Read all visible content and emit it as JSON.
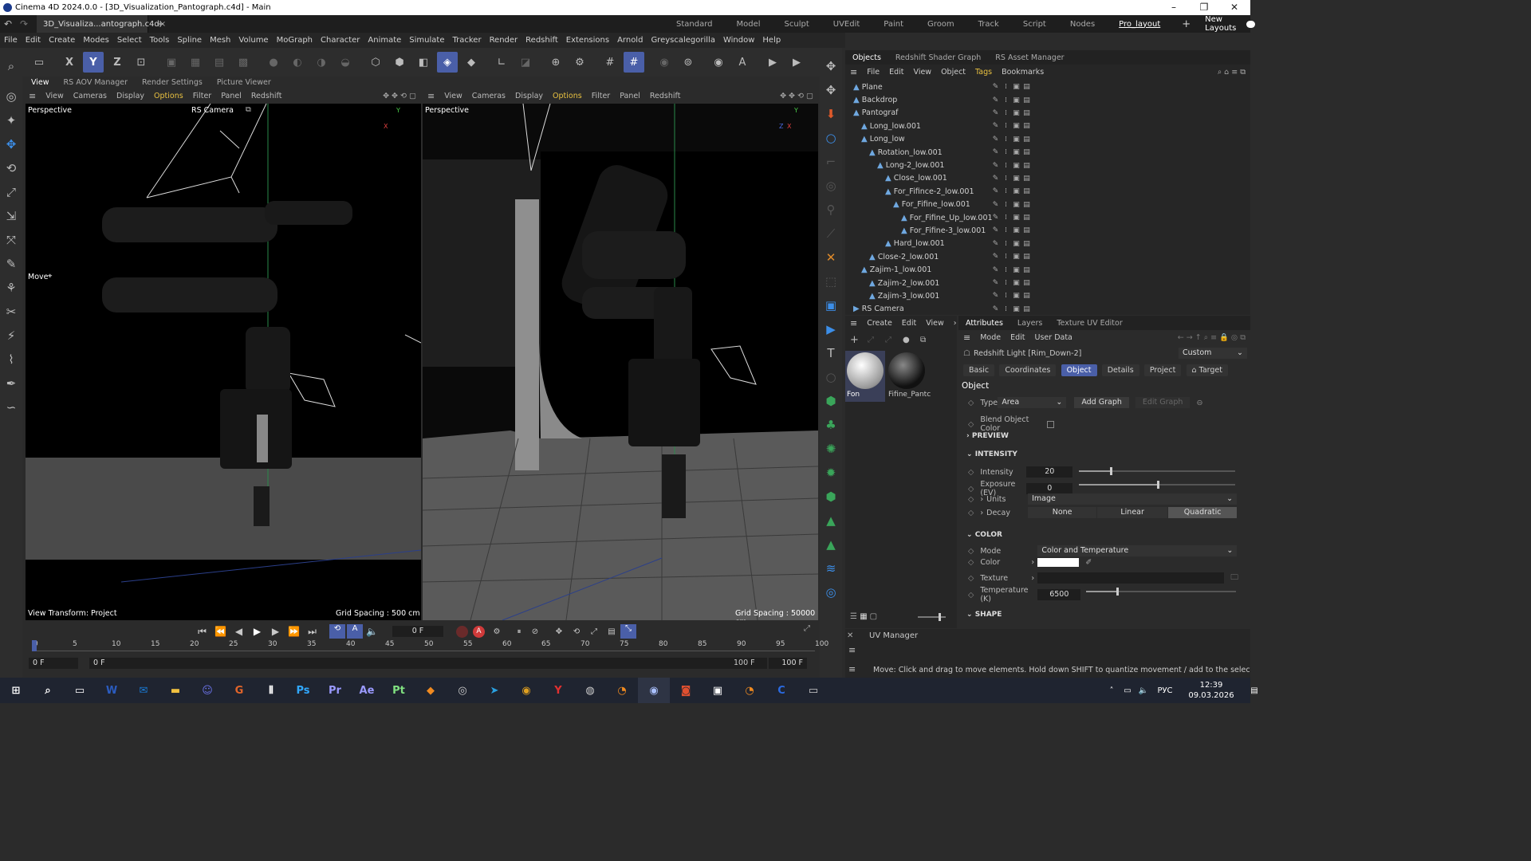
{
  "window": {
    "title": "Cinema 4D 2024.0.0 - [3D_Visualization_Pantograph.c4d] - Main",
    "controls": [
      "–",
      "❐",
      "✕"
    ]
  },
  "tabbar": {
    "doc_tab": "3D_Visualiza...antograph.c4d",
    "close": "×",
    "add": "+",
    "layouts": [
      "Standard",
      "Model",
      "Sculpt",
      "UVEdit",
      "Paint",
      "Groom",
      "Track",
      "Script",
      "Nodes",
      "Pro_layout"
    ],
    "active_layout": "Pro_layout",
    "new_layouts": "New Layouts"
  },
  "menu": [
    "File",
    "Edit",
    "Create",
    "Modes",
    "Select",
    "Tools",
    "Spline",
    "Mesh",
    "Volume",
    "MoGraph",
    "Character",
    "Animate",
    "Simulate",
    "Tracker",
    "Render",
    "Redshift",
    "Extensions",
    "Arnold",
    "Greyscalegorilla",
    "Window",
    "Help"
  ],
  "toolbar": {
    "axis": [
      "X",
      "Y",
      "Z"
    ]
  },
  "view_tabs": [
    "View",
    "RS AOV Manager",
    "Render Settings",
    "Picture Viewer"
  ],
  "viewport_menu": [
    "View",
    "Cameras",
    "Display",
    "Options",
    "Filter",
    "Panel",
    "Redshift"
  ],
  "viewport_left": {
    "label": "Perspective",
    "camera": "RS Camera",
    "tool_hint": "Move",
    "view_transform": "View Transform: Project",
    "grid": "Grid Spacing : 500 cm",
    "axis_labels": [
      "Y",
      "X"
    ]
  },
  "viewport_right": {
    "label": "Perspective",
    "grid": "Grid Spacing : 50000 cm",
    "axis_labels": [
      "Y",
      "Z",
      "X"
    ]
  },
  "objects_panel": {
    "tabs": [
      "Objects",
      "Redshift Shader Graph",
      "RS Asset Manager"
    ],
    "menu": [
      "File",
      "Edit",
      "View",
      "Object",
      "Tags",
      "Bookmarks"
    ],
    "items": [
      {
        "name": "Plane",
        "depth": 0
      },
      {
        "name": "Backdrop",
        "depth": 0
      },
      {
        "name": "Pantograf",
        "depth": 0
      },
      {
        "name": "Long_low.001",
        "depth": 1
      },
      {
        "name": "Long_low",
        "depth": 1
      },
      {
        "name": "Rotation_low.001",
        "depth": 2
      },
      {
        "name": "Long-2_low.001",
        "depth": 3
      },
      {
        "name": "Close_low.001",
        "depth": 4
      },
      {
        "name": "For_Fifince-2_low.001",
        "depth": 4
      },
      {
        "name": "For_Fifine_low.001",
        "depth": 5
      },
      {
        "name": "For_Fifine_Up_low.001",
        "depth": 6
      },
      {
        "name": "For_Fifine-3_low.001",
        "depth": 6
      },
      {
        "name": "Hard_low.001",
        "depth": 4
      },
      {
        "name": "Close-2_low.001",
        "depth": 2
      },
      {
        "name": "Zajim-1_low.001",
        "depth": 1
      },
      {
        "name": "Zajim-2_low.001",
        "depth": 2
      },
      {
        "name": "Zajim-3_low.001",
        "depth": 2
      },
      {
        "name": "RS Camera",
        "depth": 0
      }
    ]
  },
  "materials": {
    "menu": [
      "Create",
      "Edit",
      "View",
      "›"
    ],
    "items": [
      "Fon",
      "Fifine_Pantc"
    ]
  },
  "attributes": {
    "tabs": [
      "Attributes",
      "Layers",
      "Texture UV Editor"
    ],
    "menu": [
      "Mode",
      "Edit",
      "User Data"
    ],
    "object_name": "Redshift Light [Rim_Down-2]",
    "preset": "Custom",
    "subtabs": [
      "Basic",
      "Coordinates",
      "Object",
      "Details",
      "Project",
      "Target"
    ],
    "active_subtab": "Object",
    "section_object": "Object",
    "type_label": "Type",
    "type_value": "Area",
    "add_graph": "Add Graph",
    "edit_graph": "Edit Graph",
    "blend_label": "Blend Object Color",
    "preview": "PREVIEW",
    "intensity_section": "INTENSITY",
    "intensity_label": "Intensity",
    "intensity_value": "20",
    "exposure_label": "Exposure (EV)",
    "exposure_value": "0",
    "units_label": "Units",
    "units_value": "Image",
    "decay_label": "Decay",
    "decay_options": [
      "None",
      "Linear",
      "Quadratic"
    ],
    "decay_active": "Quadratic",
    "color_section": "COLOR",
    "mode_label": "Mode",
    "mode_value": "Color and Temperature",
    "color_label": "Color",
    "texture_label": "Texture",
    "temperature_label": "Temperature (K)",
    "temperature_value": "6500",
    "shape_section": "SHAPE",
    "intensity_slider": 0.2,
    "exposure_slider": 0.5,
    "temperature_slider": 0.2
  },
  "timeline": {
    "current_frame": "0 F",
    "ticks": [
      "0",
      "5",
      "10",
      "15",
      "20",
      "25",
      "30",
      "35",
      "40",
      "45",
      "50",
      "55",
      "60",
      "65",
      "70",
      "75",
      "80",
      "85",
      "90",
      "95",
      "100"
    ],
    "start_a": "0 F",
    "start_b": "0 F",
    "end_a": "100 F",
    "end_b": "100 F"
  },
  "uv_manager": {
    "title": "UV Manager"
  },
  "status": "Move: Click and drag to move elements. Hold down SHIFT to quantize movement / add to the selection in point mode",
  "taskbar": {
    "lang": "РУС",
    "time": "12:39",
    "date": "09.03.2026"
  },
  "colors": {
    "accent": "#4a5fa8",
    "bg": "#2b2b2b",
    "highlight": "#e8c040"
  }
}
